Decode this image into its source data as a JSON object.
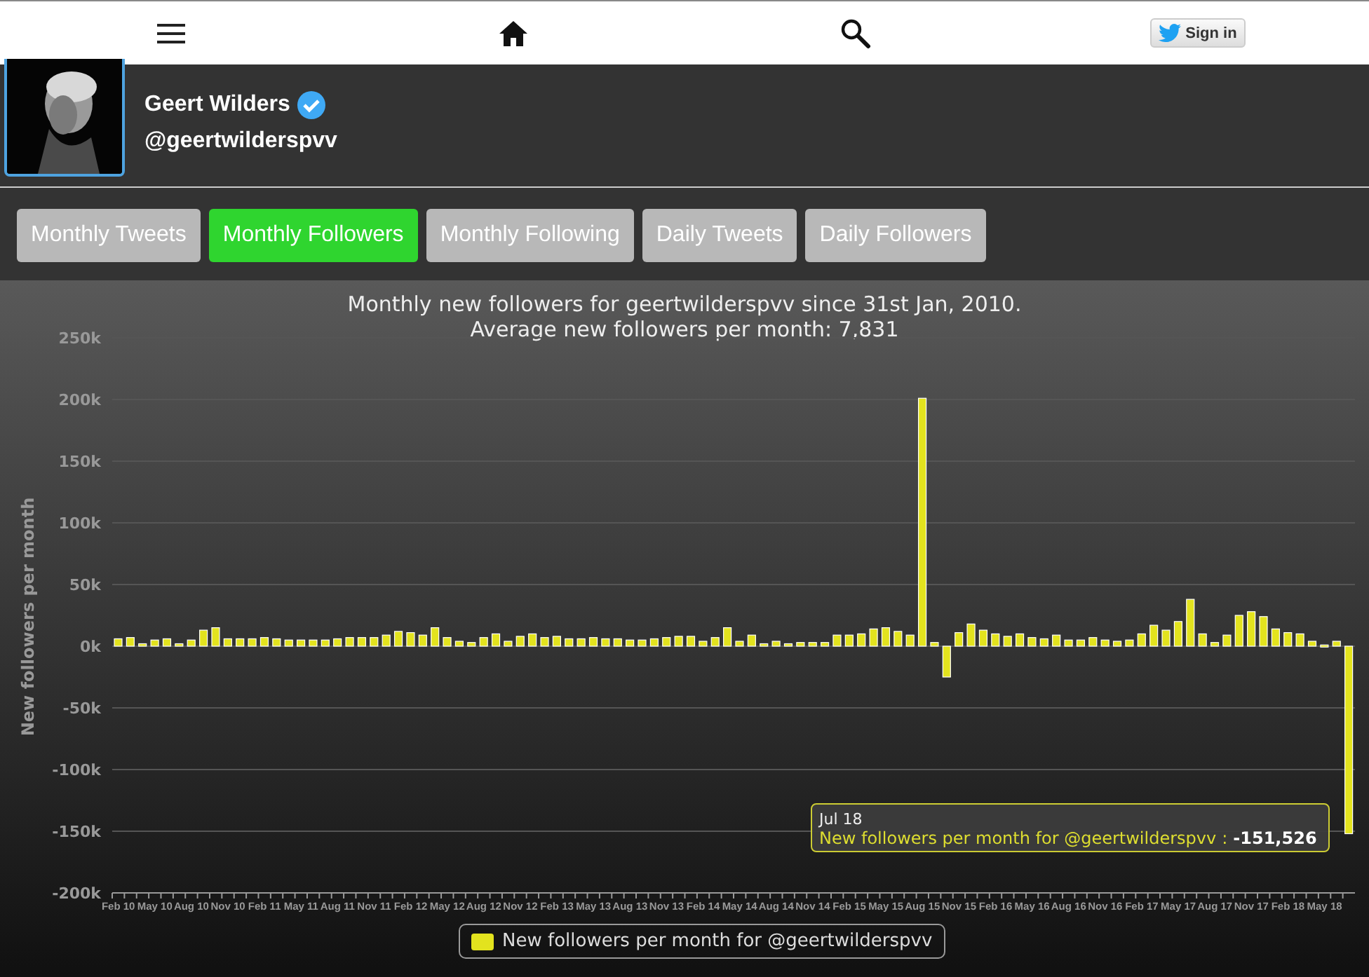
{
  "nav": {
    "sign_in": "Sign in"
  },
  "profile": {
    "name": "Geert Wilders",
    "verified": true,
    "handle": "@geertwilderspvv"
  },
  "tabs": [
    {
      "label": "Monthly Tweets",
      "selected": false
    },
    {
      "label": "Monthly Followers",
      "selected": true
    },
    {
      "label": "Monthly Following",
      "selected": false
    },
    {
      "label": "Daily Tweets",
      "selected": false
    },
    {
      "label": "Daily Followers",
      "selected": false
    }
  ],
  "chart": {
    "chart_data": {
      "type": "bar",
      "title": "Monthly new followers for geertwilderspvv since 31st Jan, 2010.\nAverage new followers per month: 7,831",
      "ylabel": "New followers per month",
      "ylim": [
        -200000,
        250000
      ],
      "yticks": [
        {
          "value": -200000,
          "label": "-200k"
        },
        {
          "value": -150000,
          "label": "-150k"
        },
        {
          "value": -100000,
          "label": "-100k"
        },
        {
          "value": -50000,
          "label": "-50k"
        },
        {
          "value": 0,
          "label": "0k"
        },
        {
          "value": 50000,
          "label": "50k"
        },
        {
          "value": 100000,
          "label": "100k"
        },
        {
          "value": 150000,
          "label": "150k"
        },
        {
          "value": 200000,
          "label": "200k"
        },
        {
          "value": 250000,
          "label": "250k"
        }
      ],
      "grid": true,
      "categories": [
        "Feb 10",
        null,
        null,
        "May 10",
        null,
        null,
        "Aug 10",
        null,
        null,
        "Nov 10",
        null,
        null,
        "Feb 11",
        null,
        null,
        "May 11",
        null,
        null,
        "Aug 11",
        null,
        null,
        "Nov 11",
        null,
        null,
        "Feb 12",
        null,
        null,
        "May 12",
        null,
        null,
        "Aug 12",
        null,
        null,
        "Nov 12",
        null,
        null,
        "Feb 13",
        null,
        null,
        "May 13",
        null,
        null,
        "Aug 13",
        null,
        null,
        "Nov 13",
        null,
        null,
        "Feb 14",
        null,
        null,
        "May 14",
        null,
        null,
        "Aug 14",
        null,
        null,
        "Nov 14",
        null,
        null,
        "Feb 15",
        null,
        null,
        "May 15",
        null,
        null,
        "Aug 15",
        null,
        null,
        "Nov 15",
        null,
        null,
        "Feb 16",
        null,
        null,
        "May 16",
        null,
        null,
        "Aug 16",
        null,
        null,
        "Nov 16",
        null,
        null,
        "Feb 17",
        null,
        null,
        "May 17",
        null,
        null,
        "Aug 17",
        null,
        null,
        "Nov 17",
        null,
        null,
        "Feb 18",
        null,
        null,
        "May 18",
        null,
        null
      ],
      "series": [
        {
          "name": "New followers per month for @geertwilderspvv",
          "color": "#e3e31e",
          "values": [
            6000,
            7000,
            2000,
            5000,
            6000,
            2000,
            5000,
            13000,
            15000,
            6000,
            6000,
            6000,
            7000,
            6000,
            5000,
            5000,
            5000,
            5000,
            6000,
            7000,
            7000,
            7000,
            9000,
            12000,
            11000,
            9000,
            15000,
            7000,
            4000,
            3000,
            7000,
            10000,
            4000,
            8000,
            10000,
            7000,
            8000,
            6000,
            6000,
            7000,
            6000,
            6000,
            5000,
            5000,
            6000,
            7000,
            8000,
            8000,
            4000,
            7000,
            15000,
            4000,
            9000,
            2000,
            4000,
            2000,
            3000,
            3000,
            3000,
            9000,
            9000,
            10000,
            14000,
            15000,
            12000,
            9000,
            201000,
            3000,
            -25000,
            11000,
            18000,
            13000,
            10000,
            8000,
            10000,
            7000,
            6000,
            9000,
            5000,
            5000,
            7000,
            5000,
            4000,
            5000,
            10000,
            17000,
            13000,
            20000,
            38000,
            10000,
            3000,
            9000,
            25000,
            28000,
            24000,
            14000,
            11000,
            10000,
            4000,
            1000,
            4000,
            -152000
          ]
        }
      ]
    },
    "tooltip": {
      "date": "Jul 18",
      "series": "New followers per month for @geertwilderspvv",
      "separator": ":",
      "value": "-151,526"
    }
  }
}
